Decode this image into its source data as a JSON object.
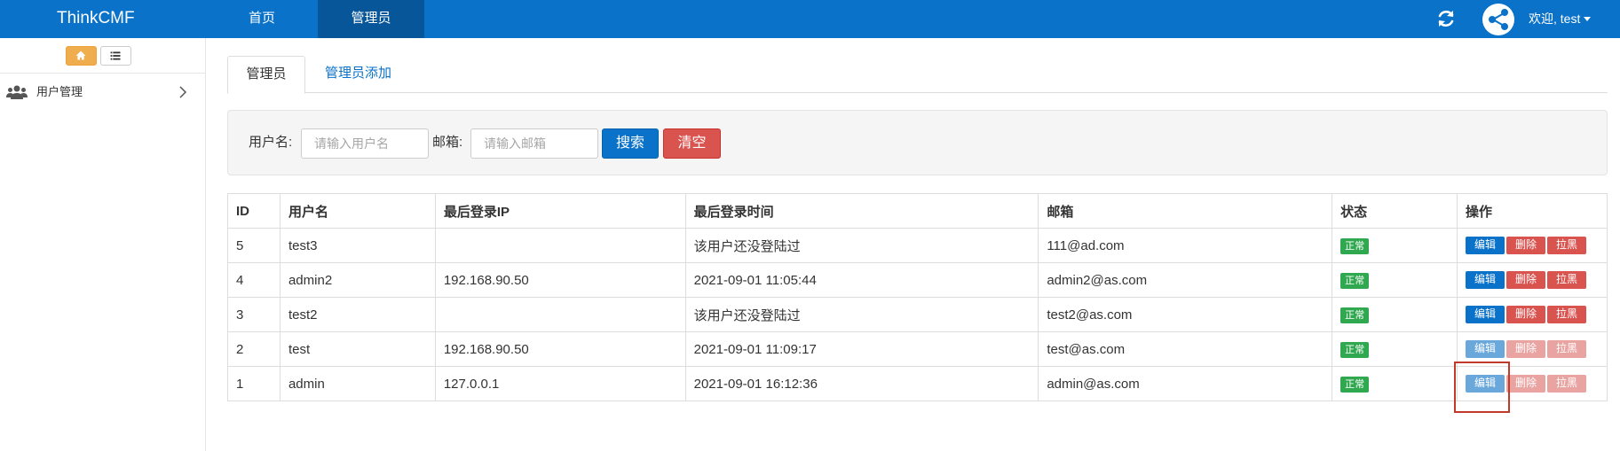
{
  "navbar": {
    "brand": "ThinkCMF",
    "items": [
      {
        "label": "首页"
      },
      {
        "label": "管理员"
      }
    ],
    "welcome": "欢迎, test",
    "refresh_icon": "refresh-icon",
    "avatar_icon": "share-node-icon"
  },
  "sidebar": {
    "tools": [
      "home-icon",
      "list-icon"
    ],
    "items": [
      {
        "label": "用户管理",
        "icon": "users-icon"
      }
    ]
  },
  "tabs": [
    {
      "label": "管理员",
      "active": true
    },
    {
      "label": "管理员添加",
      "active": false
    }
  ],
  "search": {
    "username_label": "用户名:",
    "username_placeholder": "请输入用户名",
    "email_label": "邮箱:",
    "email_placeholder": "请输入邮箱",
    "search_button": "搜索",
    "clear_button": "清空"
  },
  "table": {
    "headers": [
      "ID",
      "用户名",
      "最后登录IP",
      "最后登录时间",
      "邮箱",
      "状态",
      "操作"
    ],
    "rows": [
      {
        "id": "5",
        "username": "test3",
        "ip": "",
        "time": "该用户还没登陆过",
        "email": "111@ad.com",
        "status": "正常"
      },
      {
        "id": "4",
        "username": "admin2",
        "ip": "192.168.90.50",
        "time": "2021-09-01 11:05:44",
        "email": "admin2@as.com",
        "status": "正常"
      },
      {
        "id": "3",
        "username": "test2",
        "ip": "",
        "time": "该用户还没登陆过",
        "email": "test2@as.com",
        "status": "正常"
      },
      {
        "id": "2",
        "username": "test",
        "ip": "192.168.90.50",
        "time": "2021-09-01 11:09:17",
        "email": "test@as.com",
        "status": "正常"
      },
      {
        "id": "1",
        "username": "admin",
        "ip": "127.0.0.1",
        "time": "2021-09-01 16:12:36",
        "email": "admin@as.com",
        "status": "正常"
      }
    ],
    "actions": {
      "edit": "编辑",
      "delete": "删除",
      "blacklist": "拉黑"
    }
  },
  "colors": {
    "primary": "#0a72c8",
    "danger": "#d9534f",
    "success": "#2fa84f",
    "warning": "#f0ad4e"
  }
}
